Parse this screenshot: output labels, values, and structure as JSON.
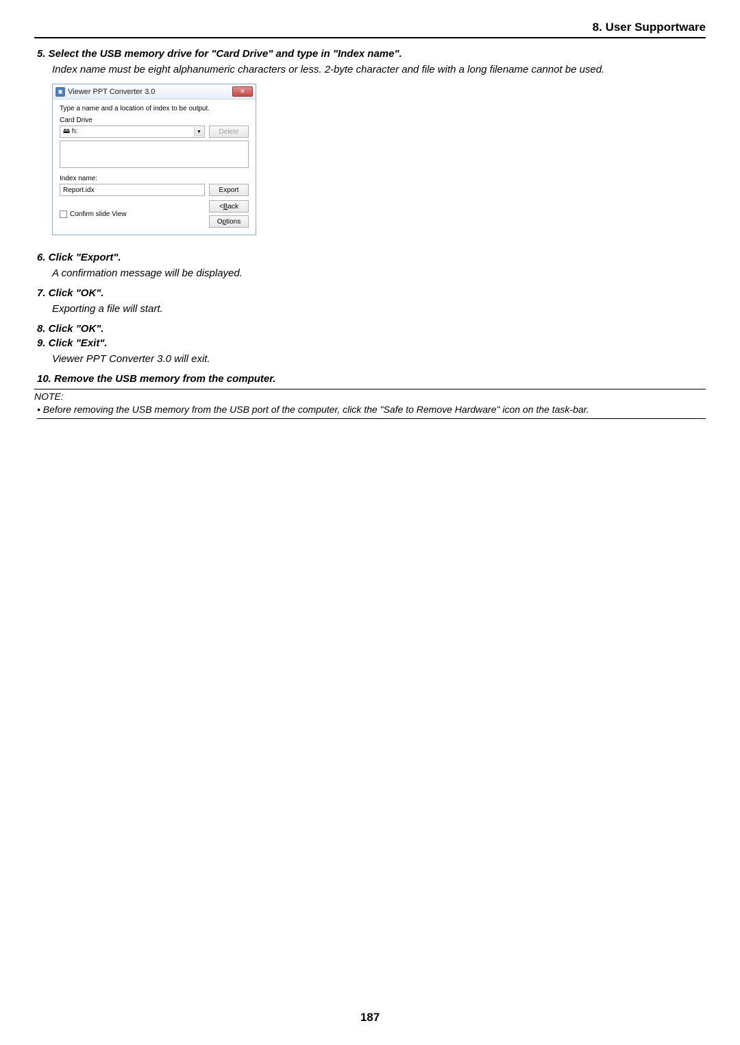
{
  "header": {
    "title": "8. User Supportware"
  },
  "steps": {
    "s5": {
      "title": "5.  Select the USB memory drive for \"Card Drive\" and type in \"Index name\".",
      "desc": "Index name must be eight alphanumeric characters or less. 2-byte character and file with a long filename cannot be used."
    },
    "s6": {
      "title": "6.  Click \"Export\".",
      "desc": "A confirmation message will be displayed."
    },
    "s7": {
      "title": "7.  Click \"OK\".",
      "desc": "Exporting a file will start."
    },
    "s8": {
      "title": "8.  Click \"OK\"."
    },
    "s9": {
      "title": "9.  Click \"Exit\".",
      "desc": "Viewer PPT Converter 3.0 will exit."
    },
    "s10": {
      "title": "10. Remove the USB memory from the computer."
    }
  },
  "dialog": {
    "title": "Viewer PPT Converter 3.0",
    "instruction": "Type a name and a location of index to be output.",
    "card_drive_label": "Card Drive",
    "card_drive_value": "🖴 h:",
    "delete_btn": "Delete",
    "index_name_label": "Index name:",
    "index_name_value": "Report.idx",
    "export_btn": "Export",
    "confirm_checkbox": "Confirm slide View",
    "back_btn": "< Back",
    "back_btn_u": "B",
    "options_btn": "Options",
    "options_btn_u": "p",
    "close_btn": "✕"
  },
  "note": {
    "label": "NOTE:",
    "text": "•  Before removing the USB memory from the USB port of the computer, click the \"Safe to Remove Hardware\" icon on the task-bar."
  },
  "page_number": "187"
}
